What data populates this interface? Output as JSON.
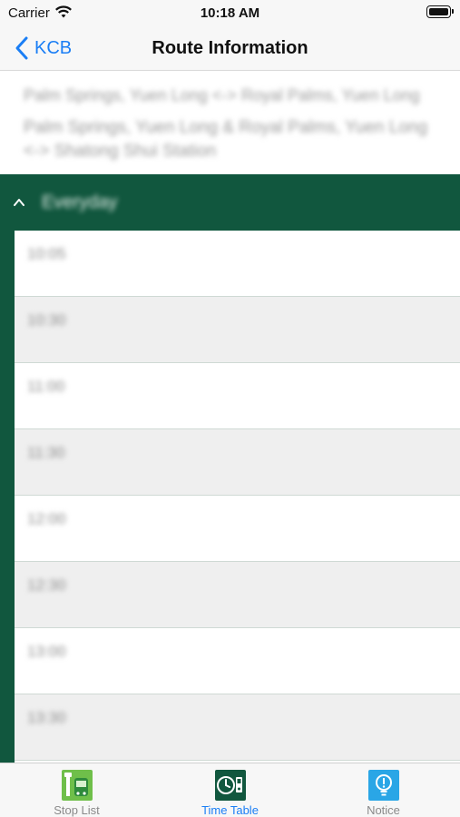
{
  "status_bar": {
    "carrier": "Carrier",
    "time": "10:18 AM"
  },
  "nav": {
    "back_label": "KCB",
    "title": "Route Information"
  },
  "route": {
    "line1": "Palm Springs, Yuen Long <-> Royal Palms, Yuen Long",
    "line2": "Palm Springs, Yuen Long & Royal Palms, Yuen Long <-> Shatong Shui Station"
  },
  "section": {
    "label": "Everyday"
  },
  "times": [
    "10:05",
    "10:30",
    "11:00",
    "11:30",
    "12:00",
    "12:30",
    "13:00",
    "13:30"
  ],
  "tabs": [
    {
      "label": "Stop List",
      "icon": "stop-list-icon"
    },
    {
      "label": "Time Table",
      "icon": "time-table-icon"
    },
    {
      "label": "Notice",
      "icon": "notice-icon"
    }
  ],
  "colors": {
    "accent": "#1a7ef5",
    "brand_green": "#11573e",
    "row_alt": "#efefef"
  }
}
